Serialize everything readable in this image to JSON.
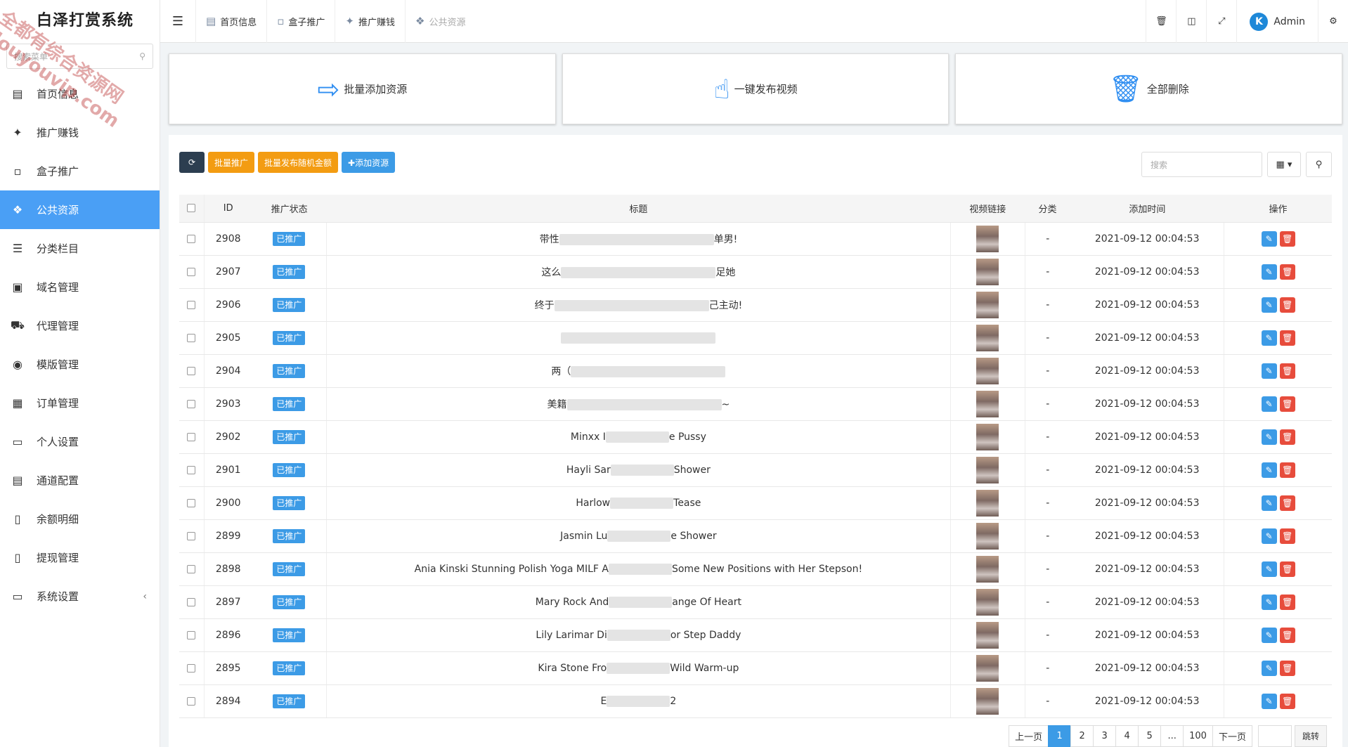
{
  "app": {
    "title": "白泽打赏系统"
  },
  "sidebar": {
    "search_placeholder": "搜索菜单",
    "items": [
      {
        "label": "首页信息",
        "icon": "dashboard-icon"
      },
      {
        "label": "推广赚钱",
        "icon": "drone-icon"
      },
      {
        "label": "盒子推广",
        "icon": "box-icon"
      },
      {
        "label": "公共资源",
        "icon": "network-icon",
        "active": true
      },
      {
        "label": "分类栏目",
        "icon": "list-icon"
      },
      {
        "label": "域名管理",
        "icon": "domain-icon"
      },
      {
        "label": "代理管理",
        "icon": "cart-icon"
      },
      {
        "label": "模版管理",
        "icon": "template-icon"
      },
      {
        "label": "订单管理",
        "icon": "order-icon"
      },
      {
        "label": "个人设置",
        "icon": "person-icon"
      },
      {
        "label": "通道配置",
        "icon": "channel-icon"
      },
      {
        "label": "余额明细",
        "icon": "balance-icon"
      },
      {
        "label": "提现管理",
        "icon": "withdraw-icon"
      },
      {
        "label": "系统设置",
        "icon": "settings-icon"
      }
    ]
  },
  "topbar": {
    "tabs": [
      {
        "label": "首页信息"
      },
      {
        "label": "盒子推广"
      },
      {
        "label": "推广赚钱"
      },
      {
        "label": "公共资源"
      }
    ],
    "admin_label": "Admin",
    "avatar_letter": "K"
  },
  "cards": [
    {
      "label": "批量添加资源",
      "icon": "import-icon"
    },
    {
      "label": "一键发布视频",
      "icon": "hand-pointer-icon"
    },
    {
      "label": "全部删除",
      "icon": "trash-icon"
    }
  ],
  "toolbar": {
    "batch_promote": "批量推广",
    "batch_random": "批量发布随机金额",
    "add_resource": "✚添加资源",
    "search_placeholder": "搜索"
  },
  "table": {
    "headers": [
      "ID",
      "推广状态",
      "标题",
      "视频链接",
      "分类",
      "添加时间",
      "操作"
    ],
    "rows": [
      {
        "id": "2908",
        "status": "已推广",
        "title_pre": "带性",
        "title_post": "单男!",
        "category": "-",
        "time": "2021-09-12 00:04:53"
      },
      {
        "id": "2907",
        "status": "已推广",
        "title_pre": "这么",
        "title_post": "足她",
        "category": "-",
        "time": "2021-09-12 00:04:53"
      },
      {
        "id": "2906",
        "status": "已推广",
        "title_pre": "终于",
        "title_post": "己主动!",
        "category": "-",
        "time": "2021-09-12 00:04:53"
      },
      {
        "id": "2905",
        "status": "已推广",
        "title_pre": "",
        "title_post": "",
        "category": "-",
        "time": "2021-09-12 00:04:53"
      },
      {
        "id": "2904",
        "status": "已推广",
        "title_pre": "两（",
        "title_post": "",
        "category": "-",
        "time": "2021-09-12 00:04:53"
      },
      {
        "id": "2903",
        "status": "已推广",
        "title_pre": "美籍",
        "title_post": "~",
        "category": "-",
        "time": "2021-09-12 00:04:53"
      },
      {
        "id": "2902",
        "status": "已推广",
        "title_pre": "Minxx I",
        "title_post": "e Pussy",
        "category": "-",
        "time": "2021-09-12 00:04:53"
      },
      {
        "id": "2901",
        "status": "已推广",
        "title_pre": "Hayli Sar",
        "title_post": "Shower",
        "category": "-",
        "time": "2021-09-12 00:04:53"
      },
      {
        "id": "2900",
        "status": "已推广",
        "title_pre": "Harlow",
        "title_post": "Tease",
        "category": "-",
        "time": "2021-09-12 00:04:53"
      },
      {
        "id": "2899",
        "status": "已推广",
        "title_pre": "Jasmin Lu",
        "title_post": "e Shower",
        "category": "-",
        "time": "2021-09-12 00:04:53"
      },
      {
        "id": "2898",
        "status": "已推广",
        "title_pre": "Ania Kinski Stunning Polish Yoga MILF A",
        "title_post": "Some New Positions with Her Stepson!",
        "category": "-",
        "time": "2021-09-12 00:04:53"
      },
      {
        "id": "2897",
        "status": "已推广",
        "title_pre": "Mary Rock And",
        "title_post": "ange Of Heart",
        "category": "-",
        "time": "2021-09-12 00:04:53"
      },
      {
        "id": "2896",
        "status": "已推广",
        "title_pre": "Lily Larimar Di",
        "title_post": "or Step Daddy",
        "category": "-",
        "time": "2021-09-12 00:04:53"
      },
      {
        "id": "2895",
        "status": "已推广",
        "title_pre": "Kira Stone Fro",
        "title_post": "Wild Warm-up",
        "category": "-",
        "time": "2021-09-12 00:04:53"
      },
      {
        "id": "2894",
        "status": "已推广",
        "title_pre": "E",
        "title_post": "2",
        "category": "-",
        "time": "2021-09-12 00:04:53"
      }
    ]
  },
  "pager": {
    "prev": "上一页",
    "pages": [
      "1",
      "2",
      "3",
      "4",
      "5",
      "...",
      "100"
    ],
    "next": "下一页",
    "go": "跳转"
  },
  "watermark": {
    "line1": "全都有综合资源网",
    "line2": "douyouvip.com"
  }
}
